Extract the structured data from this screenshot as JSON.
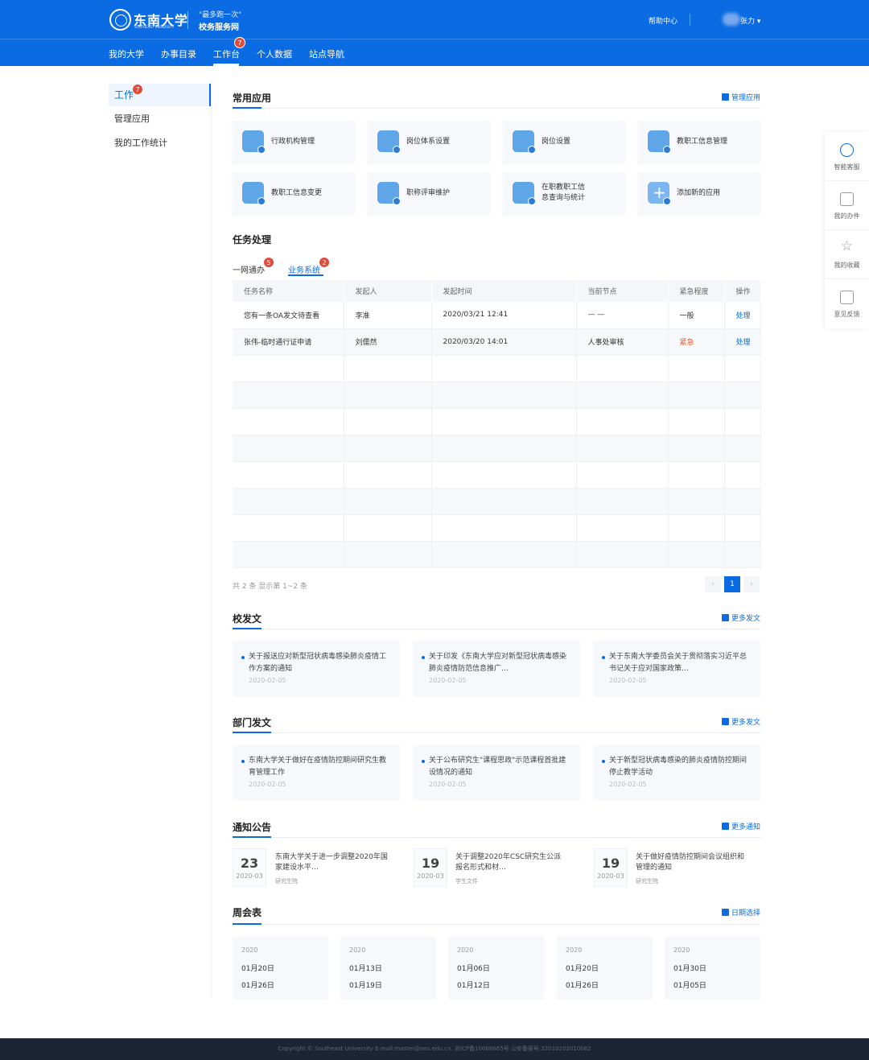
{
  "header": {
    "logo_name": "东南大学",
    "logo_en": "SOUTHEAST UNIVERSITY",
    "slogan": "\"最多跑一次\"",
    "site_name": "校务服务网",
    "help": "帮助中心",
    "user": "张力 ▾"
  },
  "nav": [
    {
      "label": "我的大学"
    },
    {
      "label": "办事目录"
    },
    {
      "label": "工作台",
      "badge": "7"
    },
    {
      "label": "个人数据"
    },
    {
      "label": "站点导航"
    }
  ],
  "sidebar": {
    "items": [
      {
        "label": "工作",
        "badge": "7"
      },
      {
        "label": "管理应用"
      },
      {
        "label": "我的工作统计"
      }
    ]
  },
  "apps": {
    "title": "常用应用",
    "manage_link": "管理应用",
    "items": [
      {
        "label": "行政机构管理",
        "icon": "user-tie-icon"
      },
      {
        "label": "岗位体系设置",
        "icon": "briefcase-icon"
      },
      {
        "label": "岗位设置",
        "icon": "clock-user-icon"
      },
      {
        "label": "教职工信息管理",
        "icon": "plane-icon"
      },
      {
        "label": "教职工信息变更",
        "icon": "doctor-icon"
      },
      {
        "label": "职称评审维护",
        "icon": "group-icon"
      },
      {
        "label": "在职教职工信\n息查询与统计",
        "icon": "chart-card-icon"
      },
      {
        "label": "添加新的应用",
        "icon": "plus-icon"
      }
    ]
  },
  "tasks": {
    "title": "任务处理",
    "tabs": [
      {
        "label": "一网通办",
        "badge": "5"
      },
      {
        "label": "业务系统",
        "badge": "2"
      }
    ],
    "columns": [
      "任务名称",
      "发起人",
      "发起时间",
      "当前节点",
      "紧急程度",
      "操作"
    ],
    "rows": [
      [
        "您有一条OA发文待查看",
        "李准",
        "2020/03/21 12:41",
        "— —",
        "一般",
        "处理"
      ],
      [
        "张伟-临时通行证申请",
        "刘儒然",
        "2020/03/20 14:01",
        "人事处审核",
        "紧急",
        "处理"
      ]
    ],
    "pager_text": "共 2 条  显示第 1~2 条",
    "page_prev": "‹",
    "page_current": "1",
    "page_next": "›"
  },
  "school_docs": {
    "title": "校发文",
    "more": "更多发文",
    "items": [
      {
        "text": "关于报送应对新型冠状病毒感染肺炎疫情工作方案的通知",
        "date": "2020-02-05"
      },
      {
        "text": "关于印发《东南大学应对新型冠状病毒感染肺炎疫情防范信息推广…",
        "date": "2020-02-05"
      },
      {
        "text": "关于东南大学委员会关于贯彻落实习近平总书记关于应对国家政策…",
        "date": "2020-02-05"
      }
    ]
  },
  "dept_docs": {
    "title": "部门发文",
    "more": "更多发文",
    "items": [
      {
        "text": "东南大学关于做好在疫情防控期间研究生教育管理工作",
        "date": "2020-02-05"
      },
      {
        "text": "关于公布研究生\"课程思政\"示范课程首批建设情况的通知",
        "date": "2020-02-05"
      },
      {
        "text": "关于新型冠状病毒感染的肺炎疫情防控期间停止教学活动",
        "date": "2020-02-05"
      }
    ]
  },
  "notices": {
    "title": "通知公告",
    "more": "更多通知",
    "items": [
      {
        "day": "23",
        "ym": "2020-03",
        "title": "东南大学关于进一步调整2020年国家建设水平…",
        "source": "研究生院"
      },
      {
        "day": "19",
        "ym": "2020-03",
        "title": "关于调整2020年CSC研究生公派报名形式和材…",
        "source": "学生文件"
      },
      {
        "day": "19",
        "ym": "2020-03",
        "title": "关于做好疫情防控期间会议组织和管理的通知",
        "source": "研究生院"
      }
    ]
  },
  "weekly": {
    "title": "周会表",
    "date_select": "日期选择",
    "items": [
      {
        "year": "2020",
        "start": "01月20日",
        "end": "01月26日"
      },
      {
        "year": "2020",
        "start": "01月13日",
        "end": "01月19日"
      },
      {
        "year": "2020",
        "start": "01月06日",
        "end": "01月12日"
      },
      {
        "year": "2020",
        "start": "01月20日",
        "end": "01月26日"
      },
      {
        "year": "2020",
        "start": "01月30日",
        "end": "01月05日"
      }
    ]
  },
  "float_panel": [
    {
      "label": "智能客服",
      "icon": "robot-icon"
    },
    {
      "label": "我的办件",
      "icon": "document-icon"
    },
    {
      "label": "我的收藏",
      "icon": "star-icon"
    },
    {
      "label": "意见反馈",
      "icon": "feedback-icon"
    }
  ],
  "footer": "Copyright © Southeast University E-mail:master@seu.edu.cn.  苏ICP备10088665号    公安备案号:32010202010062",
  "colors": {
    "primary": "#0a6be3",
    "urgent": "#e05a2c",
    "badge": "#e04b3c",
    "footer_bg": "#1c2536"
  }
}
